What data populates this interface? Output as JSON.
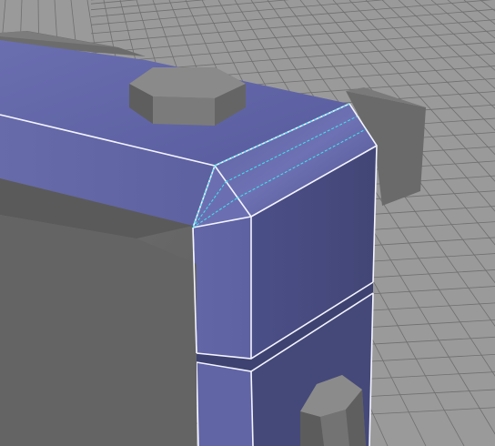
{
  "viewport": {
    "view": "perspective",
    "grid_visible": true,
    "selection_mode": "faces"
  },
  "colors": {
    "background": "#9a9a9a",
    "grid_line": "#6f6f6f",
    "grid_minor": "#858585",
    "mesh_shadow": "#5e5e5e",
    "mesh_dark": "#666666",
    "mesh_mid": "#7a7a7a",
    "mesh_light": "#8c8c8c",
    "selection_face": "#5b5fa0",
    "selection_face_dark": "#474b82",
    "selection_face_light": "#6c70b3",
    "selection_edge": "#ffffff",
    "bevel_edge": "#44e5f0"
  },
  "scene_objects": [
    {
      "name": "bolt-left-top",
      "shape": "hexagonal-bolt"
    },
    {
      "name": "bolt-right-bottom",
      "shape": "hexagonal-bolt"
    },
    {
      "name": "frame-corner",
      "shape": "beveled-box-corner",
      "selected": true
    }
  ]
}
